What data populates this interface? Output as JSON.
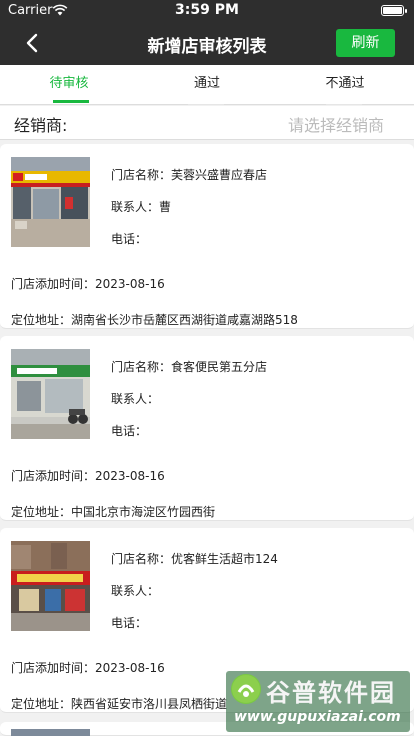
{
  "status_bar": {
    "carrier": "Carrier",
    "time": "3:59 PM",
    "battery_level": 1.0
  },
  "nav": {
    "title": "新增店审核列表",
    "refresh_label": "刷新",
    "back_icon": "chevron-left-icon"
  },
  "tabs": [
    {
      "label": "待审核",
      "active": true
    },
    {
      "label": "通过",
      "active": false
    },
    {
      "label": "不通过",
      "active": false
    }
  ],
  "dealer": {
    "label": "经销商:",
    "placeholder": "请选择经销商"
  },
  "stores": [
    {
      "name": "门店名称：芙蓉兴盛曹应春店",
      "contact": "联系人：曹",
      "phone": "电话：",
      "added": "门店添加时间：2023-08-16",
      "address": "定位地址：湖南省长沙市岳麓区西湖街道咸嘉湖路518"
    },
    {
      "name": "门店名称：食客便民第五分店",
      "contact": "联系人：",
      "phone": "电话：",
      "added": "门店添加时间：2023-08-16",
      "address": "定位地址：中国北京市海淀区竹园西街"
    },
    {
      "name": "门店名称：优客鲜生活超市124",
      "contact": "联系人：",
      "phone": "电话：",
      "added": "门店添加时间：2023-08-16",
      "address": "定位地址：陕西省延安市洛川县凤栖街道"
    }
  ],
  "watermark": {
    "name": "谷普软件园",
    "url": "www.gupuxiazai.com"
  },
  "colors": {
    "accent": "#19b83f",
    "nav_bg": "#2e2e2e",
    "page_bg": "#f1f1f1"
  }
}
